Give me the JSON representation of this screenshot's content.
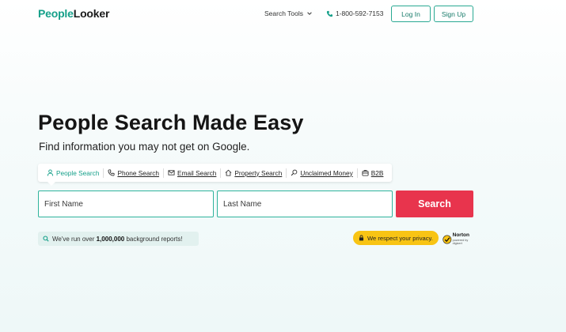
{
  "header": {
    "logo_part1": "People",
    "logo_part2": "Looker",
    "search_tools": "Search Tools",
    "phone": "1-800-592-7153",
    "login": "Log In",
    "signup": "Sign Up"
  },
  "hero": {
    "title": "People Search Made Easy",
    "subtitle": "Find information you may not get on Google."
  },
  "tabs": [
    {
      "label": "People Search",
      "icon": "person-icon",
      "active": true
    },
    {
      "label": "Phone Search",
      "icon": "phone-icon",
      "active": false
    },
    {
      "label": "Email Search",
      "icon": "envelope-icon",
      "active": false
    },
    {
      "label": "Property Search",
      "icon": "house-icon",
      "active": false
    },
    {
      "label": "Unclaimed Money",
      "icon": "magnifier-icon",
      "active": false
    },
    {
      "label": "B2B",
      "icon": "briefcase-icon",
      "active": false
    }
  ],
  "form": {
    "first_placeholder": "First Name",
    "last_placeholder": "Last Name",
    "search_button": "Search"
  },
  "badges": {
    "reports_prefix": "We've run over ",
    "reports_count": "1,000,000",
    "reports_suffix": " background reports!",
    "privacy": "We respect your privacy.",
    "norton_name": "Norton",
    "norton_sub": "powered by digicert"
  },
  "colors": {
    "brand_green": "#16a08a",
    "accent_red": "#e8344d",
    "privacy_yellow": "#f8c414"
  }
}
